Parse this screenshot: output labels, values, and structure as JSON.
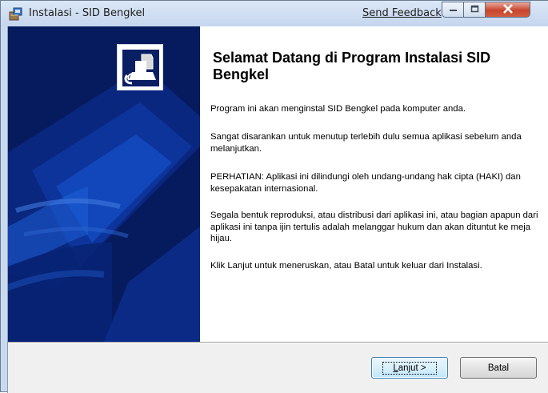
{
  "window": {
    "title": "Instalasi - SID Bengkel",
    "send_feedback": "Send Feedback"
  },
  "content": {
    "heading": "Selamat Datang di Program Instalasi SID Bengkel",
    "paragraphs": [
      "Program ini akan menginstal SID Bengkel pada komputer anda.",
      "Sangat disarankan untuk menutup terlebih dulu semua aplikasi sebelum anda melanjutkan.",
      "PERHATIAN: Aplikasi ini dilindungi oleh undang-undang hak cipta (HAKI) dan kesepakatan internasional.",
      "Segala bentuk reproduksi, atau distribusi dari aplikasi ini, atau bagian apapun dari aplikasi ini tanpa ijin tertulis adalah melanggar hukum dan akan dituntut ke meja hijau.",
      "Klik Lanjut untuk meneruskan, atau Batal untuk keluar dari Instalasi."
    ]
  },
  "buttons": {
    "next_mnemonic": "L",
    "next_rest": "anjut >",
    "cancel": "Batal"
  },
  "colors": {
    "banner_blue": "#061a5e",
    "close_red": "#c8452c"
  }
}
